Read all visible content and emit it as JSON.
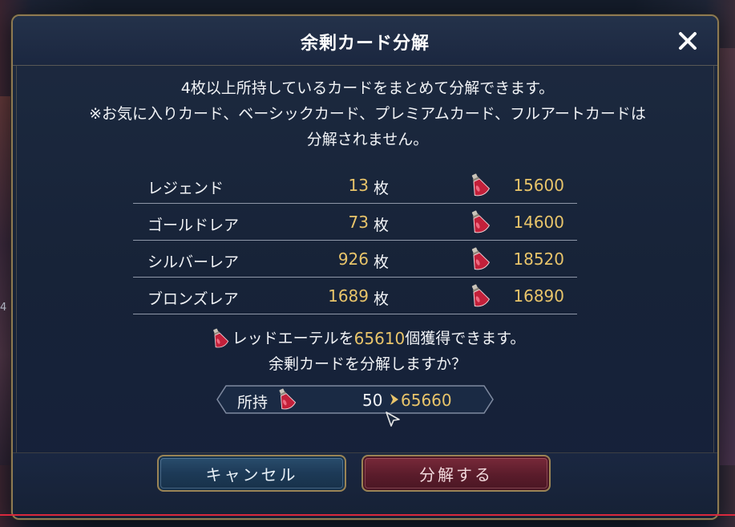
{
  "background": {
    "side_number": "4"
  },
  "dialog": {
    "title": "余剰カード分解",
    "close_label": "×",
    "description": {
      "line1": "4枚以上所持しているカードをまとめて分解できます。",
      "line2": "※お気に入りカード、ベーシックカード、プレミアムカード、フルアートカードは",
      "line3": "分解されません。"
    },
    "rows": [
      {
        "name": "レジェンド",
        "count": "13",
        "unit": "枚",
        "ether": "15600"
      },
      {
        "name": "ゴールドレア",
        "count": "73",
        "unit": "枚",
        "ether": "14600"
      },
      {
        "name": "シルバーレア",
        "count": "926",
        "unit": "枚",
        "ether": "18520"
      },
      {
        "name": "ブロンズレア",
        "count": "1689",
        "unit": "枚",
        "ether": "16890"
      }
    ],
    "result": {
      "prefix": "レッドエーテルを",
      "amount": "65610",
      "suffix": "個獲得できます。",
      "question": "余剰カードを分解しますか？"
    },
    "ownership": {
      "label": "所持",
      "from": "50",
      "to": "65660"
    },
    "buttons": {
      "cancel": "キャンセル",
      "confirm": "分解する"
    }
  },
  "colors": {
    "gold_value": "#e8c46a",
    "frame_gold": "#9a8455",
    "confirm_red": "#5a1c2b",
    "cancel_blue": "#1d3a57",
    "bottom_line": "#d9283d"
  },
  "icons": {
    "ether": "red-ether-potion-icon",
    "close": "close-icon",
    "arrow": "chevron-right-icon",
    "cursor": "mouse-cursor-icon"
  }
}
